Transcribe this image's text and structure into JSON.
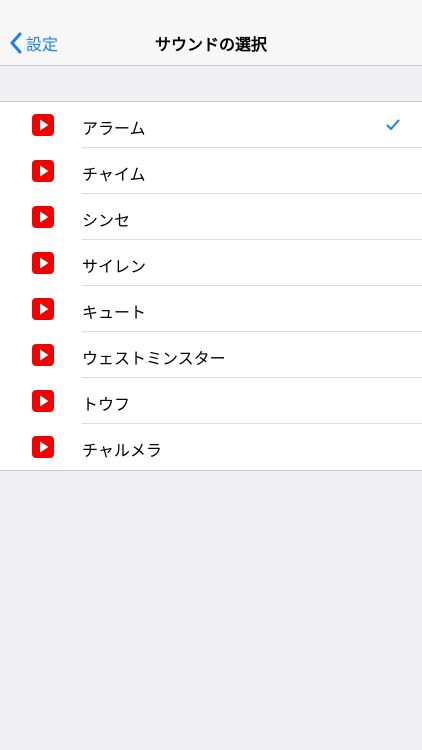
{
  "navbar": {
    "back_label": "設定",
    "title": "サウンドの選択"
  },
  "sounds": [
    {
      "label": "アラーム",
      "selected": true
    },
    {
      "label": "チャイム",
      "selected": false
    },
    {
      "label": "シンセ",
      "selected": false
    },
    {
      "label": "サイレン",
      "selected": false
    },
    {
      "label": "キュート",
      "selected": false
    },
    {
      "label": "ウェストミンスター",
      "selected": false
    },
    {
      "label": "トウフ",
      "selected": false
    },
    {
      "label": "チャルメラ",
      "selected": false
    }
  ],
  "colors": {
    "accent": "#1a7ff0",
    "icon_red": "#f30000",
    "background": "#efeff4"
  },
  "icons": {
    "back": "chevron-left-icon",
    "row_icon": "play-icon",
    "selected": "checkmark-icon"
  }
}
